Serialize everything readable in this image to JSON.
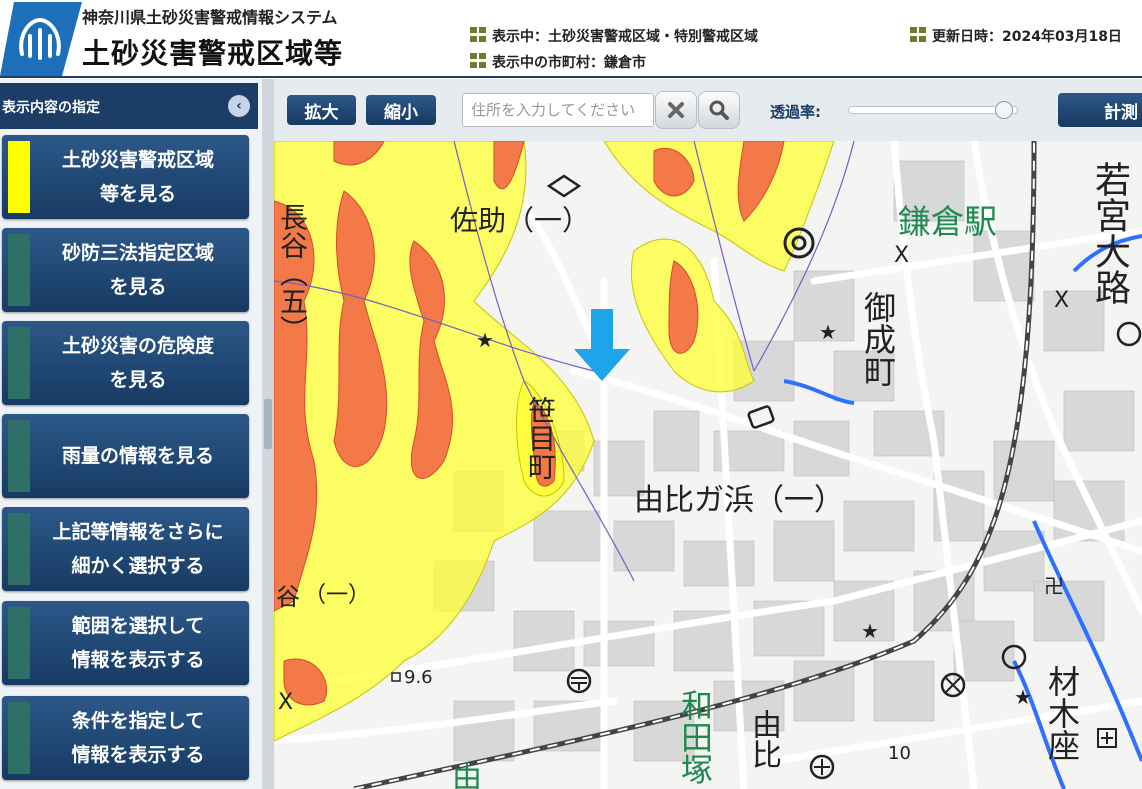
{
  "header": {
    "system_name": "神奈川県土砂災害警戒情報システム",
    "title": "土砂災害警戒区域等",
    "display_text": "表示中：土砂災害警戒区域・特別警戒区域",
    "city_text": "表示中の市町村：鎌倉市",
    "updated_text": "更新日時：2024年03月18日"
  },
  "sidebar": {
    "title": "表示内容の指定",
    "items": [
      {
        "label": "土砂災害警戒区域\n等を見る",
        "active": true
      },
      {
        "label": "砂防三法指定区域\nを見る",
        "active": false
      },
      {
        "label": "土砂災害の危険度\nを見る",
        "active": false
      },
      {
        "label": "雨量の情報を見る",
        "active": false
      },
      {
        "label": "上記等情報をさらに\n細かく選択する",
        "active": false
      },
      {
        "label": "範囲を選択して\n情報を表示する",
        "active": false
      },
      {
        "label": "条件を指定して\n情報を表示する",
        "active": false
      }
    ]
  },
  "toolbar": {
    "zoom_in_label": "拡大",
    "zoom_out_label": "縮小",
    "search_placeholder": "住所を入力してください",
    "search_value": "",
    "opacity_label": "透過率:",
    "opacity_value": 0.92,
    "measure_label": "計測"
  },
  "map": {
    "labels": {
      "kamakura_station": "鎌倉駅",
      "wakamiya_oji": "若宮大路",
      "onari_machi": "御成町",
      "yuigahama_1": "由比ガ浜（一）",
      "sasuke_1": "佐助（一）",
      "sasamecho": "笹目町",
      "hase_5": "長谷（五）",
      "wadazuka": "和田塚",
      "yui": "由比",
      "zaimokuza": "材木座",
      "hase_partial": "谷",
      "one_marker": "（一）",
      "elevation_96": "9.6",
      "elevation_10": "10",
      "yui_partial": "由"
    },
    "colors": {
      "warning_zone": "#ffff33",
      "special_warning_zone": "#f26a45",
      "boundary": "#7a5cc8",
      "water": "#3070ff",
      "location_marker": "#1ea4e8",
      "station_text": "#1e8a4f"
    },
    "icons": [
      "location-arrow-icon",
      "search-icon",
      "clear-icon",
      "shrine-icon",
      "temple-icon",
      "school-icon",
      "police-box-icon",
      "post-office-icon"
    ]
  }
}
